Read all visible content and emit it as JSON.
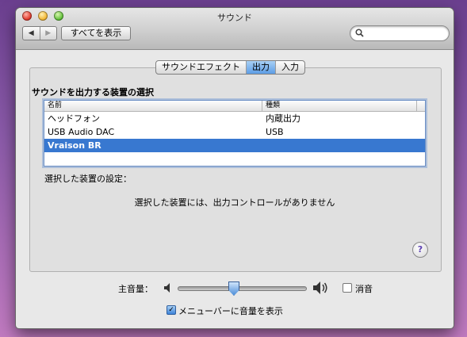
{
  "window": {
    "title": "サウンド"
  },
  "toolbar": {
    "back_icon": "◀",
    "forward_icon": "▶",
    "show_all_label": "すべてを表示",
    "search_icon": "magnifier-icon",
    "search_value": "",
    "search_placeholder": ""
  },
  "tabs": [
    {
      "label": "サウンドエフェクト",
      "active": false
    },
    {
      "label": "出力",
      "active": true
    },
    {
      "label": "入力",
      "active": false
    }
  ],
  "output": {
    "section_title": "サウンドを出力する装置の選択",
    "columns": [
      "名前",
      "種類"
    ],
    "devices": [
      {
        "name": "ヘッドフォン",
        "type": "内蔵出力",
        "selected": false
      },
      {
        "name": "USB Audio DAC",
        "type": "USB",
        "selected": false
      },
      {
        "name": "Vraison BR",
        "type": "",
        "selected": true
      }
    ],
    "settings_label": "選択した装置の設定：",
    "no_controls_message": "選択した装置には、出力コントロールがありません",
    "help_label": "?"
  },
  "volume": {
    "label": "主音量：",
    "level": 0.42,
    "mute_label": "消音",
    "mute_checked": false,
    "show_in_menubar_label": "メニューバーに音量を表示",
    "show_in_menubar_checked": true
  },
  "colors": {
    "selection": "#3878d0",
    "accent": "#5d9de6"
  }
}
